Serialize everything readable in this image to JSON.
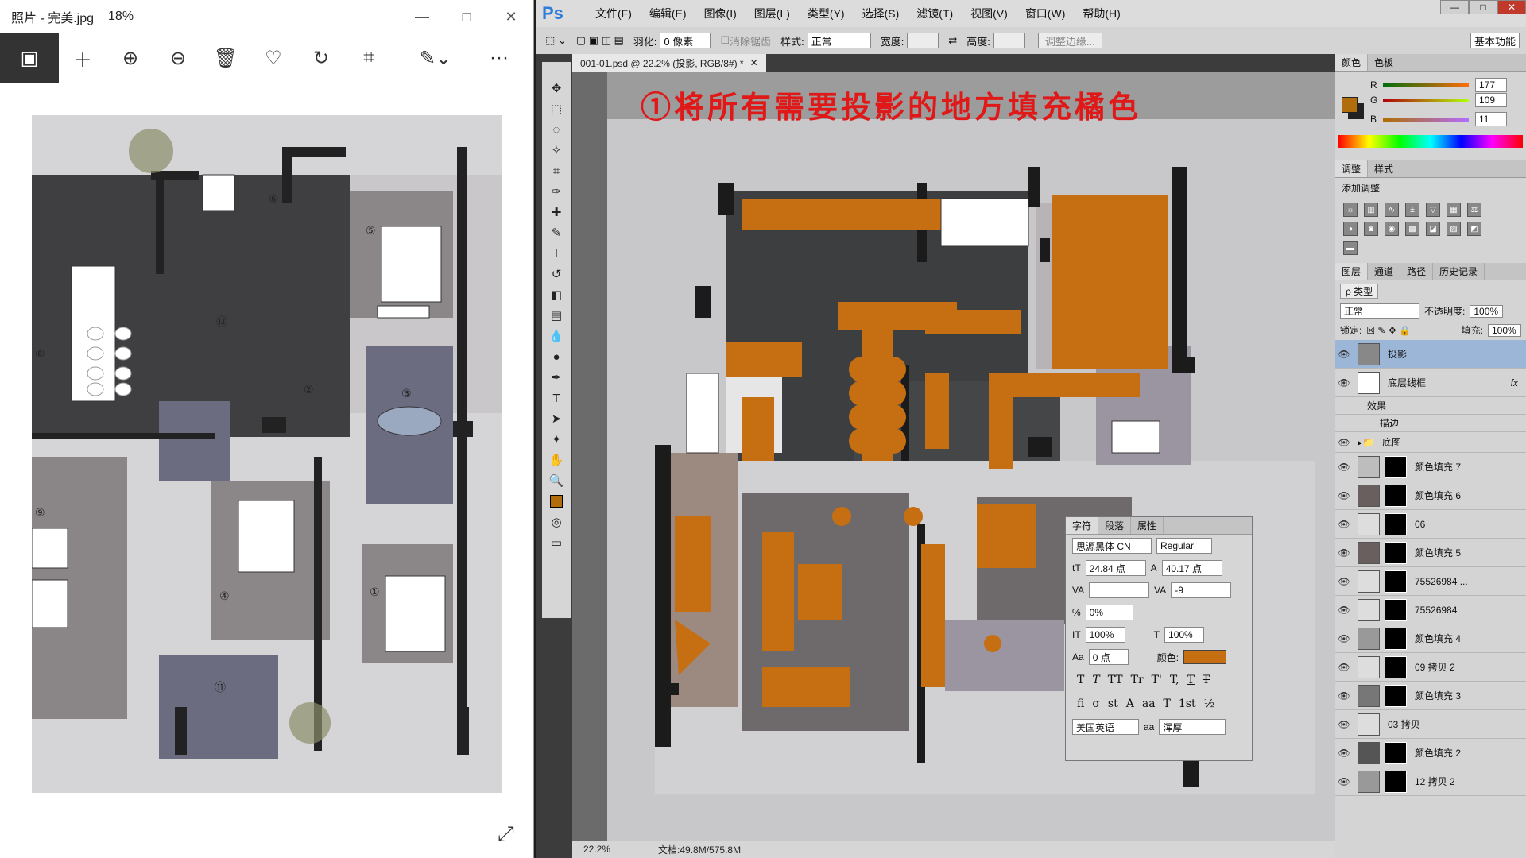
{
  "photos": {
    "title": "照片 - 完美.jpg",
    "zoom": "18%",
    "minimize_icon": "minimize-icon",
    "toolbar": [
      "gallery-icon",
      "add-icon",
      "zoom-in-icon",
      "zoom-out-icon",
      "delete-icon",
      "heart-icon",
      "rotate-icon",
      "crop-icon",
      "edit-icon",
      "more-icon"
    ],
    "room_numbers": [
      "①",
      "②",
      "③",
      "④",
      "⑤",
      "⑥",
      "⑧",
      "⑨",
      "⑪",
      "⑬"
    ]
  },
  "ps": {
    "logo": "Ps",
    "menus": [
      "文件(F)",
      "编辑(E)",
      "图像(I)",
      "图层(L)",
      "类型(Y)",
      "选择(S)",
      "滤镜(T)",
      "视图(V)",
      "窗口(W)",
      "帮助(H)"
    ],
    "options": {
      "feather_label": "羽化:",
      "feather_value": "0 像素",
      "antialias": "消除锯齿",
      "style_label": "样式:",
      "style_value": "正常",
      "width_label": "宽度:",
      "height_label": "高度:",
      "refine_button": "调整边缘...",
      "workspace": "基本功能"
    },
    "doc_tab": "001-01.psd @ 22.2% (投影, RGB/8#) *",
    "banner": "①将所有需要投影的地方填充橘色",
    "status": {
      "zoom": "22.2%",
      "doc": "文档:49.8M/575.8M"
    }
  },
  "panels": {
    "color_tabs": [
      "颜色",
      "色板"
    ],
    "r": "177",
    "g": "109",
    "b": "11",
    "r_label": "R",
    "g_label": "G",
    "b_label": "B",
    "fg_color": "#b16d0b",
    "adj_tabs": [
      "调整",
      "样式"
    ],
    "adj_title": "添加调整",
    "layer_tabs": [
      "图层",
      "通道",
      "路径",
      "历史记录"
    ],
    "filter_label": "ρ 类型",
    "blend_mode": "正常",
    "opacity_label": "不透明度:",
    "opacity": "100%",
    "lock_label": "锁定:",
    "fill_label": "填充:",
    "fill": "100%",
    "layers": [
      {
        "name": "投影",
        "selected": true
      },
      {
        "name": "底层线框",
        "selected": false,
        "fx": "fx"
      },
      {
        "name": "效果",
        "selected": false
      },
      {
        "name": "描边",
        "selected": false
      },
      {
        "name": "底图",
        "selected": false
      },
      {
        "name": "颜色填充 7",
        "selected": false
      },
      {
        "name": "颜色填充 6",
        "selected": false
      },
      {
        "name": "06",
        "selected": false
      },
      {
        "name": "颜色填充 5",
        "selected": false
      },
      {
        "name": "75526984 ...",
        "selected": false
      },
      {
        "name": "75526984",
        "selected": false
      },
      {
        "name": "颜色填充 4",
        "selected": false
      },
      {
        "name": "09 拷贝 2",
        "selected": false
      },
      {
        "name": "颜色填充 3",
        "selected": false
      },
      {
        "name": "03 拷贝",
        "selected": false
      },
      {
        "name": "颜色填充 2",
        "selected": false
      },
      {
        "name": "12 拷贝 2",
        "selected": false
      }
    ]
  },
  "char_panel": {
    "tabs": [
      "字符",
      "段落",
      "属性"
    ],
    "font": "思源黑体 CN",
    "weight": "Regular",
    "size": "24.84 点",
    "leading": "40.17 点",
    "kerning": "",
    "tracking": "-9",
    "scale_pct": "0%",
    "v_scale": "100%",
    "h_scale": "100%",
    "baseline": "0 点",
    "color_label": "颜色:",
    "color": "#c56e12",
    "language": "美国英语",
    "aa_label": "aa",
    "aa": "浑厚",
    "type_buttons": [
      "T",
      "T",
      "TT",
      "Tr",
      "T'",
      "T,",
      "T",
      "T"
    ],
    "ot_buttons": [
      "fi",
      "σ",
      "st",
      "A",
      "aa",
      "T",
      "1st",
      "½"
    ]
  }
}
